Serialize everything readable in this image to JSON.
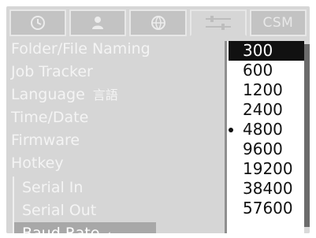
{
  "tabs": [
    {
      "id": "tab-1",
      "icon": "clock-icon",
      "label": ""
    },
    {
      "id": "tab-2",
      "icon": "person-icon",
      "label": ""
    },
    {
      "id": "tab-3",
      "icon": "globe-icon",
      "label": ""
    },
    {
      "id": "tab-4",
      "icon": "sliders-icon",
      "label": ""
    },
    {
      "id": "tab-5",
      "icon": "",
      "label": "CSM"
    }
  ],
  "menu": {
    "items": [
      {
        "label": "Folder/File Naming"
      },
      {
        "label": "Job Tracker"
      },
      {
        "label": "Language",
        "glyph": "言語"
      },
      {
        "label": "Time/Date"
      },
      {
        "label": "Firmware"
      },
      {
        "label": "Hotkey"
      }
    ],
    "submenu": [
      {
        "label": "Serial In"
      },
      {
        "label": "Serial Out"
      },
      {
        "label": "Baud Rate",
        "arrow": "◢",
        "selected": true
      }
    ]
  },
  "dropdown": {
    "options": [
      "300",
      "600",
      "1200",
      "2400",
      "4800",
      "9600",
      "19200",
      "38400",
      "57600"
    ],
    "highlighted_index": 0,
    "current_index": 4
  },
  "colors": {
    "screen_bg": "#d6d6d6",
    "menu_text": "#f4f4f4",
    "dropdown_bg": "#ffffff",
    "highlight": "#111111"
  }
}
